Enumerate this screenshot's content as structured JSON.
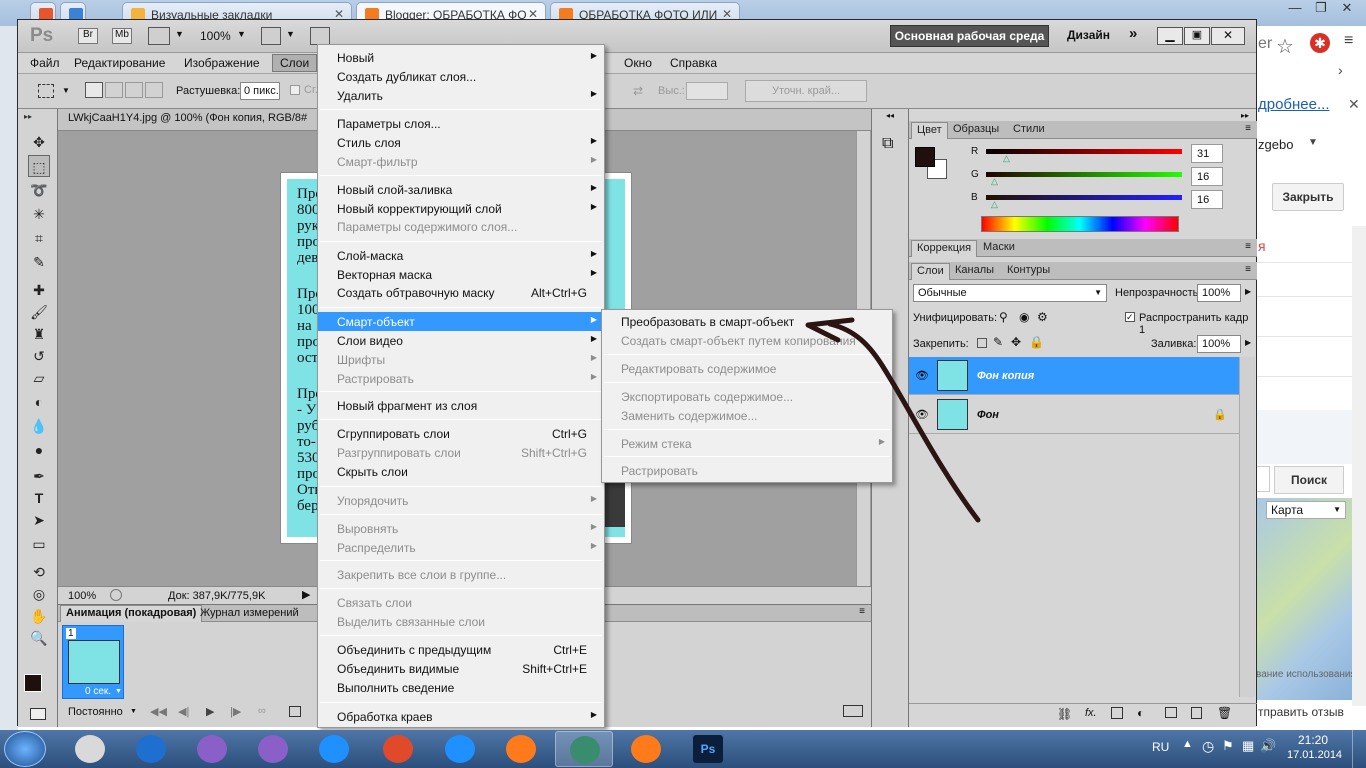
{
  "browser": {
    "tabs": [
      {
        "label": "Визуальные закладки",
        "color": "#f3b33d"
      },
      {
        "label": "Blogger: ОБРАБОТКА ФО",
        "color": "#f47c20"
      },
      {
        "label": "ОБРАБОТКА ФОТО ИЛИ",
        "color": "#f47c20"
      }
    ],
    "side": {
      "frag_er": "er",
      "frag_more": "дробнее...",
      "frag_gebo": "zgebo",
      "close_btn": "Закрыть",
      "frag_ya": "я",
      "search_btn": "Поиск",
      "map_select": "Карта",
      "frag_usage": "вание использования",
      "frag_send": "тправить отзыв"
    }
  },
  "ps": {
    "logo": "Ps",
    "zoom": "100%",
    "workspace": "Основная рабочая среда",
    "design": "Дизайн",
    "bridge": "Br",
    "minibridge": "Mb",
    "menu": [
      "Файл",
      "Редактирование",
      "Изображение",
      "Слои",
      "Окно",
      "Справка"
    ],
    "options": {
      "feather_label": "Растушевка:",
      "feather_value": "0 пикс.",
      "smooth": "Сгл",
      "height_label": "Выс.:",
      "refine_edge": "Уточн. край..."
    },
    "document": {
      "tab": "LWkjCaaH1Y4.jpg @ 100% (Фон копия, RGB/8#",
      "canvas_lines": [
        "Пре",
        "800",
        "рук",
        "про",
        "дев",
        "Пре",
        "100",
        "на",
        "про",
        "ост",
        "Пре",
        "- У",
        "руб",
        "то-",
        "530",
        "про",
        "Отн",
        "бер"
      ],
      "status_zoom": "100%",
      "status_doc": "Док: 387,9K/775,9K"
    },
    "animation": {
      "tab_anim": "Анимация (покадровая)",
      "tab_journal": "Журнал измерений",
      "frame_num": "1",
      "frame_time": "0 сек.",
      "loop": "Постоянно"
    },
    "color_panel": {
      "tabs": [
        "Цвет",
        "Образцы",
        "Стили"
      ],
      "r_label": "R",
      "g_label": "G",
      "b_label": "B",
      "r": "31",
      "g": "16",
      "b": "16",
      "foreground": "#1f1010"
    },
    "correction_tabs": [
      "Коррекция",
      "Маски"
    ],
    "layers_panel": {
      "tabs": [
        "Слои",
        "Каналы",
        "Контуры"
      ],
      "blend": "Обычные",
      "opacity_label": "Непрозрачность:",
      "opacity": "100%",
      "unify_label": "Унифицировать:",
      "propagate": "Распространить кадр 1",
      "lock_label": "Закрепить:",
      "fill_label": "Заливка:",
      "fill": "100%",
      "layers": [
        {
          "name": "Фон копия",
          "selected": true
        },
        {
          "name": "Фон",
          "selected": false
        }
      ]
    }
  },
  "layer_menu": {
    "items": [
      {
        "label": "Новый",
        "arrow": true
      },
      {
        "label": "Создать дубликат слоя...",
        "arrow": false
      },
      {
        "label": "Удалить",
        "arrow": true
      },
      {
        "label": "Параметры слоя...",
        "arrow": false
      },
      {
        "label": "Стиль слоя",
        "arrow": true
      },
      {
        "label": "Смарт-фильтр",
        "arrow": true,
        "disabled": true
      },
      {
        "label": "Новый слой-заливка",
        "arrow": true
      },
      {
        "label": "Новый корректирующий слой",
        "arrow": true
      },
      {
        "label": "Параметры содержимого слоя...",
        "disabled": true
      },
      {
        "label": "Слой-маска",
        "arrow": true
      },
      {
        "label": "Векторная маска",
        "arrow": true
      },
      {
        "label": "Создать обтравочную маску",
        "shortcut": "Alt+Ctrl+G"
      },
      {
        "label": "Смарт-объект",
        "arrow": true,
        "highlight": true
      },
      {
        "label": "Слои видео",
        "arrow": true
      },
      {
        "label": "Шрифты",
        "arrow": true,
        "disabled": true
      },
      {
        "label": "Растрировать",
        "arrow": true,
        "disabled": true
      },
      {
        "label": "Новый фрагмент из слоя"
      },
      {
        "label": "Сгруппировать слои",
        "shortcut": "Ctrl+G"
      },
      {
        "label": "Разгруппировать слои",
        "shortcut": "Shift+Ctrl+G",
        "disabled": true
      },
      {
        "label": "Скрыть слои"
      },
      {
        "label": "Упорядочить",
        "arrow": true,
        "disabled": true
      },
      {
        "label": "Выровнять",
        "arrow": true,
        "disabled": true
      },
      {
        "label": "Распределить",
        "arrow": true,
        "disabled": true
      },
      {
        "label": "Закрепить все слои в группе...",
        "disabled": true
      },
      {
        "label": "Связать слои",
        "disabled": true
      },
      {
        "label": "Выделить связанные слои",
        "disabled": true
      },
      {
        "label": "Объединить с предыдущим",
        "shortcut": "Ctrl+E"
      },
      {
        "label": "Объединить видимые",
        "shortcut": "Shift+Ctrl+E"
      },
      {
        "label": "Выполнить сведение"
      },
      {
        "label": "Обработка краев",
        "arrow": true
      }
    ]
  },
  "smart_menu": {
    "items": [
      {
        "label": "Преобразовать в смарт-объект"
      },
      {
        "label": "Создать смарт-объект путем копирования",
        "disabled": true
      },
      {
        "label": "Редактировать содержимое",
        "disabled": true
      },
      {
        "label": "Экспортировать содержимое...",
        "disabled": true
      },
      {
        "label": "Заменить содержимое...",
        "disabled": true
      },
      {
        "label": "Режим стека",
        "arrow": true,
        "disabled": true
      },
      {
        "label": "Растрировать",
        "disabled": true
      }
    ]
  },
  "taskbar": {
    "lang": "RU",
    "time": "21:20",
    "date": "17.01.2014",
    "apps": [
      "explorer",
      "media",
      "vs1",
      "vs2",
      "ie1",
      "chrome",
      "ie2",
      "firefox1",
      "monitor",
      "firefox2",
      "photoshop"
    ]
  }
}
